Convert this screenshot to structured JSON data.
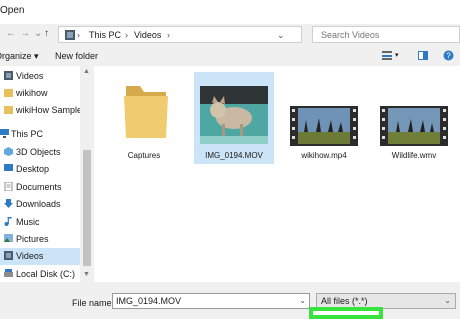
{
  "window": {
    "title": "Open"
  },
  "nav": {
    "back": "←",
    "forward": "→",
    "recent": "⌄",
    "up": "↑"
  },
  "address": {
    "path": [
      "This PC",
      "Videos"
    ],
    "sep": "›",
    "dropdown": "⌄"
  },
  "search": {
    "placeholder": "Search Videos"
  },
  "toolbar": {
    "organize": "Organize ▾",
    "new_folder": "New folder",
    "view": "▾"
  },
  "sidebar": {
    "items": [
      {
        "label": "Videos",
        "icon": "video-folder-icon"
      },
      {
        "label": "wikihow",
        "icon": "folder-icon"
      },
      {
        "label": "wikiHow Sample",
        "icon": "folder-icon"
      },
      {
        "label": "This PC",
        "icon": "computer-icon"
      },
      {
        "label": "3D Objects",
        "icon": "cube-icon"
      },
      {
        "label": "Desktop",
        "icon": "desktop-icon"
      },
      {
        "label": "Documents",
        "icon": "document-icon"
      },
      {
        "label": "Downloads",
        "icon": "download-icon"
      },
      {
        "label": "Music",
        "icon": "music-icon"
      },
      {
        "label": "Pictures",
        "icon": "picture-icon"
      },
      {
        "label": "Videos",
        "icon": "video-folder-icon"
      },
      {
        "label": "Local Disk (C:)",
        "icon": "drive-icon"
      }
    ],
    "selected_index": 10,
    "scroll_up": "▲",
    "scroll_down": "▼"
  },
  "files": [
    {
      "name": "Captures",
      "type": "folder"
    },
    {
      "name": "IMG_0194.MOV",
      "type": "video"
    },
    {
      "name": "wikihow.mp4",
      "type": "video"
    },
    {
      "name": "Wildlife.wmv",
      "type": "video"
    }
  ],
  "selected_file": "IMG_0194.MOV",
  "bottom": {
    "file_name_label": "File name:",
    "file_name_value": "IMG_0194.MOV",
    "file_type": "All files (*.*)",
    "dropdown": "⌄"
  },
  "colors": {
    "selection": "#cce4f7",
    "highlight": "#38e33d",
    "folder": "#e8c15d"
  }
}
